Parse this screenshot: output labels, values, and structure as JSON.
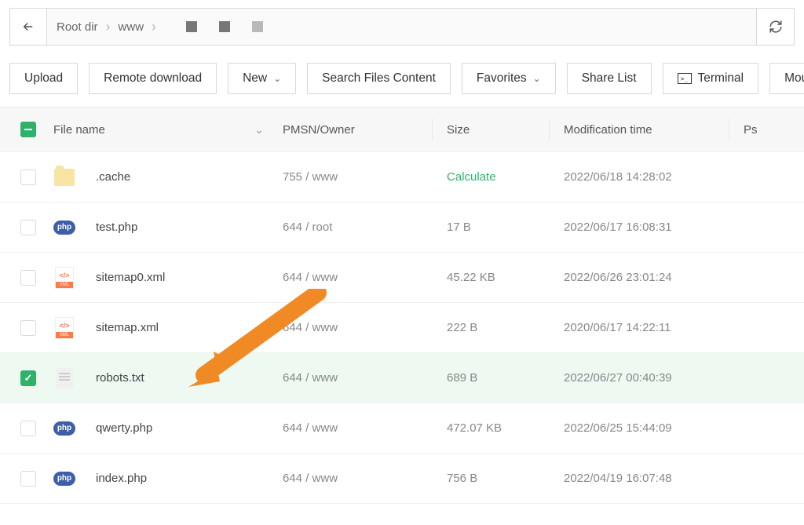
{
  "breadcrumbs": [
    "Root dir",
    "www"
  ],
  "toolbar": {
    "upload": "Upload",
    "remote_download": "Remote download",
    "new": "New",
    "search": "Search Files Content",
    "favorites": "Favorites",
    "share": "Share List",
    "terminal": "Terminal",
    "mounted": "Mounted"
  },
  "columns": {
    "name": "File name",
    "pmsn": "PMSN/Owner",
    "size": "Size",
    "mtime": "Modification time",
    "ps": "Ps"
  },
  "rows": [
    {
      "type": "folder",
      "name": ".cache",
      "pmsn": "755 / www",
      "size": "Calculate",
      "size_calc": true,
      "mtime": "2022/06/18 14:28:02",
      "checked": false
    },
    {
      "type": "php",
      "name": "test.php",
      "pmsn": "644 / root",
      "size": "17 B",
      "size_calc": false,
      "mtime": "2022/06/17 16:08:31",
      "checked": false
    },
    {
      "type": "xml",
      "name": "sitemap0.xml",
      "pmsn": "644 / www",
      "size": "45.22 KB",
      "size_calc": false,
      "mtime": "2022/06/26 23:01:24",
      "checked": false
    },
    {
      "type": "xml",
      "name": "sitemap.xml",
      "pmsn": "644 / www",
      "size": "222 B",
      "size_calc": false,
      "mtime": "2020/06/17 14:22:11",
      "checked": false
    },
    {
      "type": "txt",
      "name": "robots.txt",
      "pmsn": "644 / www",
      "size": "689 B",
      "size_calc": false,
      "mtime": "2022/06/27 00:40:39",
      "checked": true
    },
    {
      "type": "php",
      "name": "qwerty.php",
      "pmsn": "644 / www",
      "size": "472.07 KB",
      "size_calc": false,
      "mtime": "2022/06/25 15:44:09",
      "checked": false
    },
    {
      "type": "php",
      "name": "index.php",
      "pmsn": "644 / www",
      "size": "756 B",
      "size_calc": false,
      "mtime": "2022/04/19 16:07:48",
      "checked": false
    }
  ]
}
